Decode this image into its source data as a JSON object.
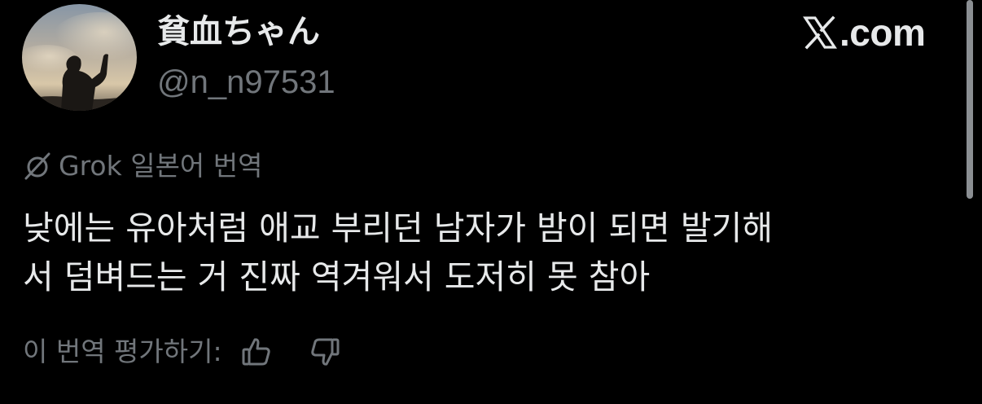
{
  "author": {
    "display_name": "貧血ちゃん",
    "handle": "@n_n97531"
  },
  "brand": {
    "text": ".com",
    "icon": "x-logo-icon"
  },
  "translation": {
    "label": "Grok 일본어 번역",
    "icon": "grok-icon"
  },
  "tweet": {
    "lines": [
      "낮에는 유아처럼 애교 부리던 남자가 밤이 되면 발기해",
      "서 덤벼드는 거 진짜 역겨워서 도저히 못 참아"
    ]
  },
  "rating": {
    "label": "이 번역 평가하기:",
    "thumbs_up_icon": "thumbs-up-icon",
    "thumbs_down_icon": "thumbs-down-icon"
  },
  "colors": {
    "background": "#000000",
    "primary_text": "#e7e9ea",
    "secondary_text": "#71767b"
  }
}
